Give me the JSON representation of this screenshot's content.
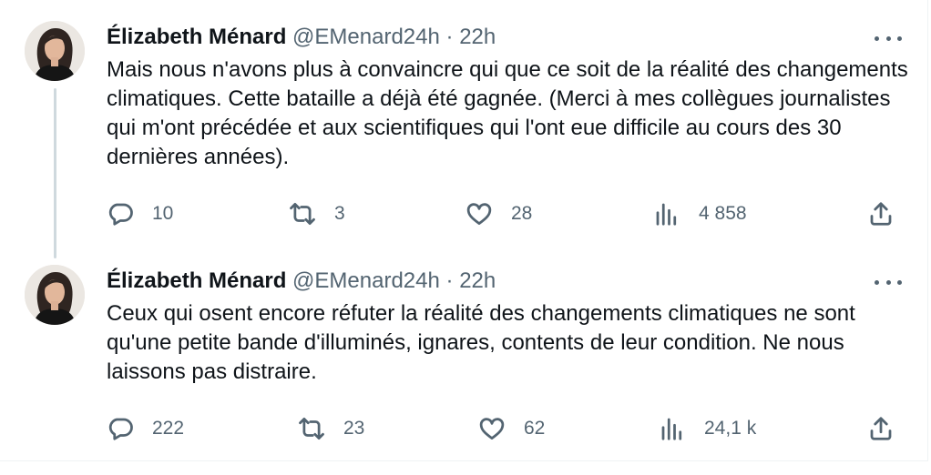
{
  "tweets": [
    {
      "author": "Élizabeth Ménard",
      "handle": "@EMenard24h",
      "separator": "·",
      "time": "22h",
      "text": "Mais nous n'avons plus à convaincre qui que ce soit de la réalité des changements climatiques. Cette bataille a déjà été gagnée. (Merci à mes collègues journalistes qui m'ont précédée et aux scientifiques qui l'ont eue difficile au cours des 30 dernières années).",
      "replies": "10",
      "retweets": "3",
      "likes": "28",
      "views": "4 858"
    },
    {
      "author": "Élizabeth Ménard",
      "handle": "@EMenard24h",
      "separator": "·",
      "time": "22h",
      "text": "Ceux qui osent encore réfuter la réalité des changements climatiques ne sont qu'une petite bande d'illuminés, ignares, contents de leur condition. Ne nous laissons pas distraire.",
      "replies": "222",
      "retweets": "23",
      "likes": "62",
      "views": "24,1 k"
    }
  ],
  "icons": {
    "more": "more-horizontal-icon",
    "reply": "reply-icon",
    "retweet": "retweet-icon",
    "like": "heart-icon",
    "views": "analytics-icon",
    "share": "share-icon"
  },
  "colors": {
    "text": "#0f1419",
    "secondary": "#536471",
    "thread_line": "#cfd9de"
  }
}
